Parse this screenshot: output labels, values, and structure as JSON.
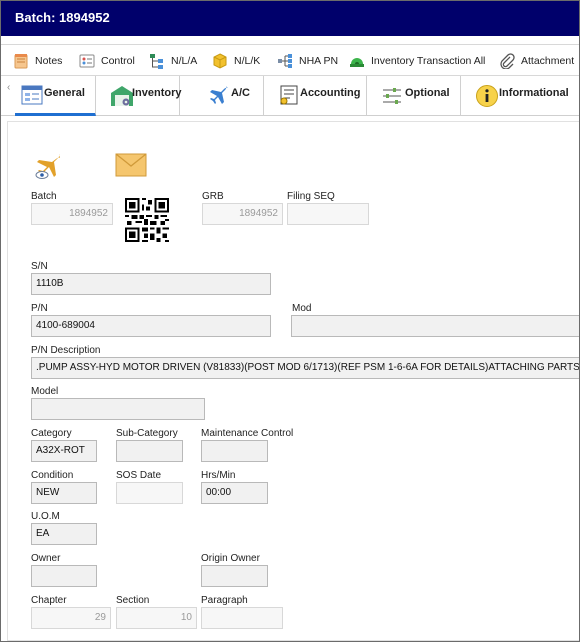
{
  "window": {
    "title": "Batch: 1894952"
  },
  "toolbar": {
    "items": [
      {
        "label": "Notes"
      },
      {
        "label": "Control"
      },
      {
        "label": "N/L/A"
      },
      {
        "label": "N/L/K"
      },
      {
        "label": "NHA PN"
      },
      {
        "label": "Inventory Transaction All"
      },
      {
        "label": "Attachment"
      }
    ]
  },
  "tabs": [
    {
      "label": "General",
      "active": true
    },
    {
      "label": "Inventory"
    },
    {
      "label": "A/C"
    },
    {
      "label": "Accounting"
    },
    {
      "label": "Optional"
    },
    {
      "label": "Informational"
    }
  ],
  "form": {
    "batch": {
      "label": "Batch",
      "value": "1894952"
    },
    "grb": {
      "label": "GRB",
      "value": "1894952"
    },
    "filing_seq": {
      "label": "Filing SEQ",
      "value": ""
    },
    "sn": {
      "label": "S/N",
      "value": "1110B"
    },
    "pn": {
      "label": "P/N",
      "value": "4100-689004"
    },
    "mod": {
      "label": "Mod",
      "value": ""
    },
    "pn_description": {
      "label": "P/N Description",
      "value": ".PUMP ASSY-HYD MOTOR DRIVEN (V81833)(POST MOD 6/1713)(REF PSM 1-6-6A FOR DETAILS)ATTACHING PARTS"
    },
    "model": {
      "label": "Model",
      "value": ""
    },
    "category": {
      "label": "Category",
      "value": "A32X-ROT"
    },
    "sub_category": {
      "label": "Sub-Category",
      "value": ""
    },
    "maintenance_control": {
      "label": "Maintenance Control",
      "value": ""
    },
    "condition": {
      "label": "Condition",
      "value": "NEW"
    },
    "sos_date": {
      "label": "SOS Date",
      "value": ""
    },
    "hrs_min": {
      "label": "Hrs/Min",
      "value": "00:00"
    },
    "uom": {
      "label": "U.O.M",
      "value": "EA"
    },
    "owner": {
      "label": "Owner",
      "value": ""
    },
    "origin_owner": {
      "label": "Origin Owner",
      "value": ""
    },
    "chapter": {
      "label": "Chapter",
      "value": "29"
    },
    "section": {
      "label": "Section",
      "value": "10"
    },
    "paragraph": {
      "label": "Paragraph",
      "value": ""
    }
  },
  "colors": {
    "titlebar": "#00006b",
    "active_tab_underline": "#1f6fd1"
  }
}
